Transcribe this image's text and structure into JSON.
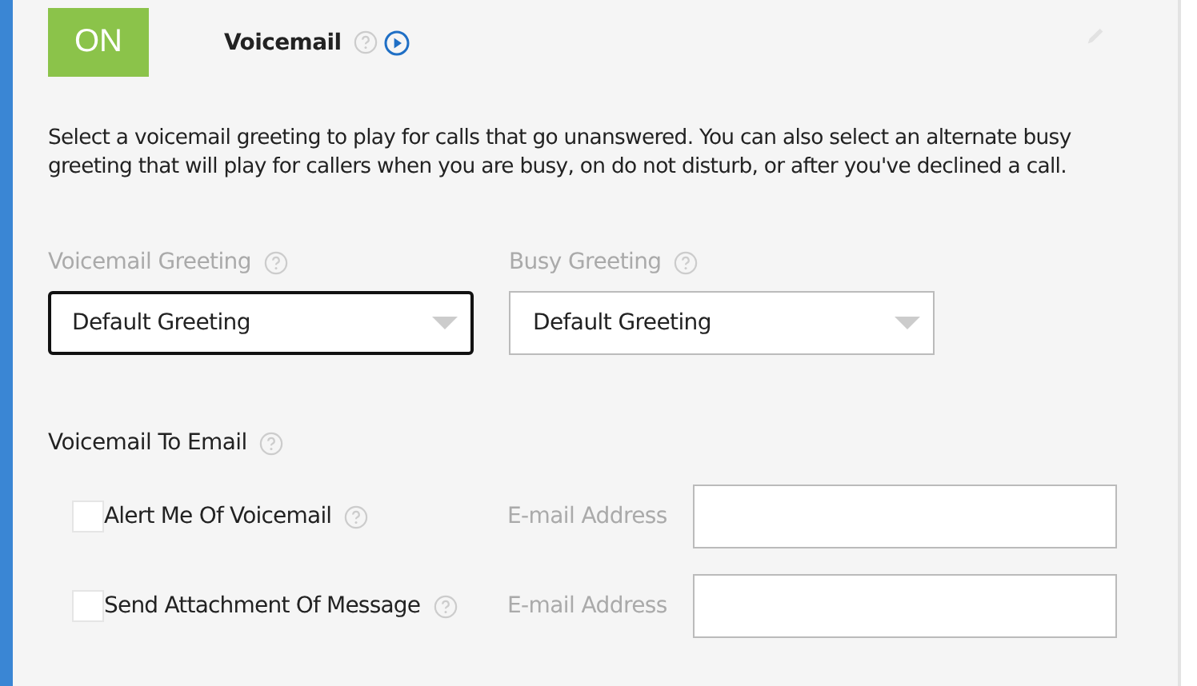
{
  "toggle": {
    "label": "ON",
    "on": true
  },
  "title": "Voicemail",
  "description": "Select a voicemail greeting to play for calls that go unanswered. You can also select an alternate busy greeting that will play for callers when you are busy, on do not disturb, or after you've declined a call.",
  "greetings": [
    {
      "label": "Voicemail Greeting",
      "value": "Default Greeting",
      "focused": true
    },
    {
      "label": "Busy Greeting",
      "value": "Default Greeting",
      "focused": false
    }
  ],
  "email_section": {
    "title": "Voicemail To Email"
  },
  "email_options": [
    {
      "label": "Alert Me Of Voicemail",
      "checked": false,
      "field_label": "E-mail Address"
    },
    {
      "label": "Send Attachment Of Message",
      "checked": false,
      "field_label": "E-mail Address"
    }
  ]
}
